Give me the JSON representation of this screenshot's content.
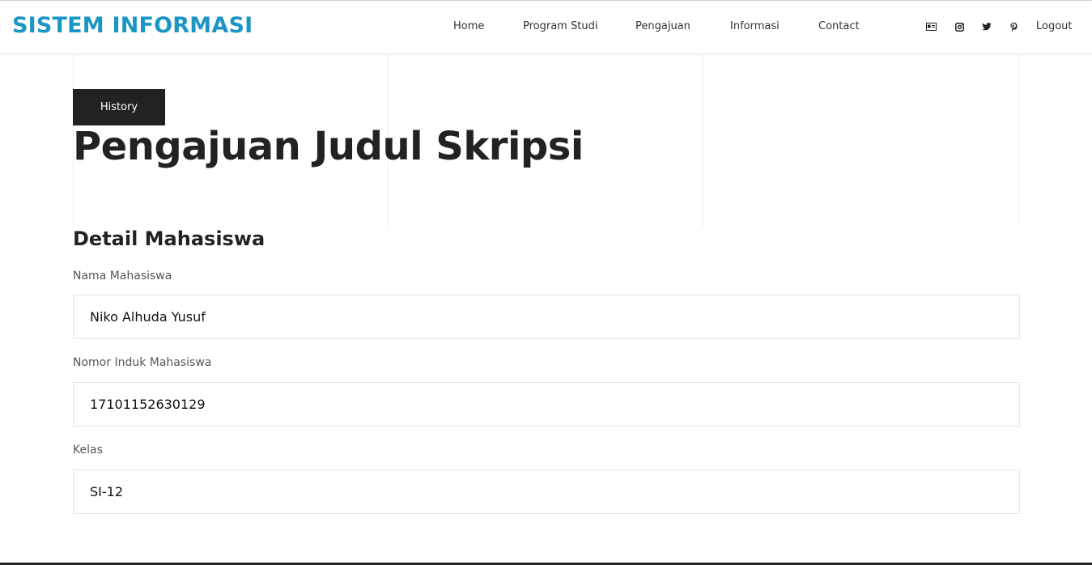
{
  "header": {
    "brand": "SISTEM INFORMASI",
    "nav": [
      "Home",
      "Program Studi",
      "Pengajuan",
      "Informasi",
      "Contact"
    ],
    "social_icons": [
      "id-card-icon",
      "instagram-icon",
      "twitter-icon",
      "pinterest-icon"
    ],
    "logout": "Logout"
  },
  "hero": {
    "badge": "History",
    "title": "Pengajuan Judul Skripsi"
  },
  "form": {
    "section_title": "Detail Mahasiswa",
    "fields": [
      {
        "label": "Nama Mahasiswa",
        "value": "Niko Alhuda Yusuf"
      },
      {
        "label": "Nomor Induk Mahasiswa",
        "value": "17101152630129"
      },
      {
        "label": "Kelas",
        "value": "SI-12"
      }
    ]
  },
  "colors": {
    "brand": "#1b96c4",
    "dark": "#222222"
  }
}
